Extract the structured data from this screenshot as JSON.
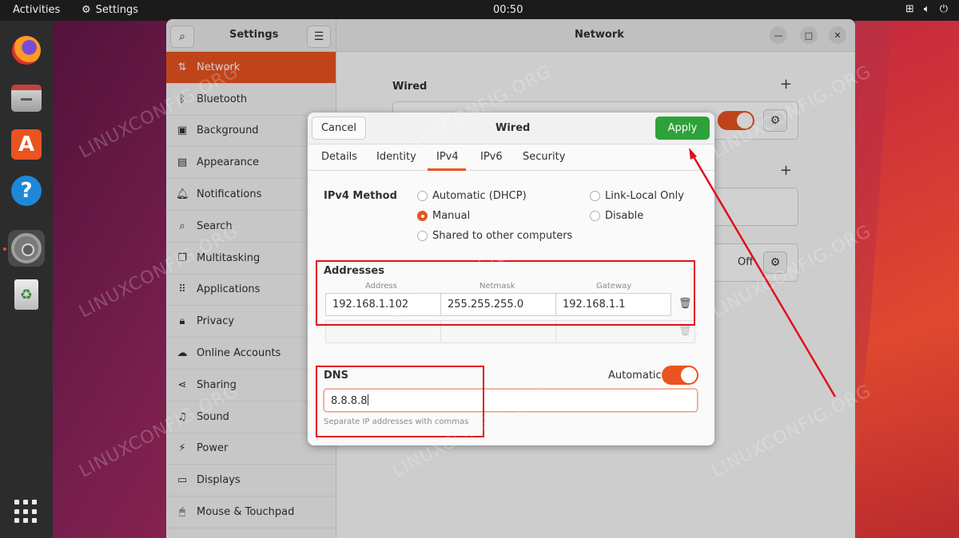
{
  "topbar": {
    "activities": "Activities",
    "app_name": "Settings",
    "clock": "00:50"
  },
  "settings": {
    "sidebar_title": "Settings",
    "main_title": "Network",
    "sidebar_items": [
      {
        "label": "Network",
        "icon": "network-icon"
      },
      {
        "label": "Bluetooth",
        "icon": "bluetooth-icon"
      },
      {
        "label": "Background",
        "icon": "background-icon"
      },
      {
        "label": "Appearance",
        "icon": "appearance-icon"
      },
      {
        "label": "Notifications",
        "icon": "bell-icon"
      },
      {
        "label": "Search",
        "icon": "search-icon"
      },
      {
        "label": "Multitasking",
        "icon": "multitasking-icon"
      },
      {
        "label": "Applications",
        "icon": "apps-grid-icon"
      },
      {
        "label": "Privacy",
        "icon": "lock-icon"
      },
      {
        "label": "Online Accounts",
        "icon": "cloud-icon"
      },
      {
        "label": "Sharing",
        "icon": "share-icon"
      },
      {
        "label": "Sound",
        "icon": "music-note-icon"
      },
      {
        "label": "Power",
        "icon": "power-icon"
      },
      {
        "label": "Displays",
        "icon": "display-icon"
      },
      {
        "label": "Mouse & Touchpad",
        "icon": "mouse-icon"
      }
    ],
    "wired_section": "Wired",
    "vpn_toggle_text": "Off"
  },
  "dialog": {
    "title": "Wired",
    "cancel": "Cancel",
    "apply": "Apply",
    "tabs": [
      "Details",
      "Identity",
      "IPv4",
      "IPv6",
      "Security"
    ],
    "active_tab": "IPv4",
    "ipv4_method_label": "IPv4 Method",
    "methods": {
      "automatic_dhcp": "Automatic (DHCP)",
      "manual": "Manual",
      "shared": "Shared to other computers",
      "link_local": "Link-Local Only",
      "disable": "Disable"
    },
    "selected_method": "Manual",
    "addresses_label": "Addresses",
    "columns": {
      "address": "Address",
      "netmask": "Netmask",
      "gateway": "Gateway"
    },
    "address_rows": [
      {
        "address": "192.168.1.102",
        "netmask": "255.255.255.0",
        "gateway": "192.168.1.1"
      },
      {
        "address": "",
        "netmask": "",
        "gateway": ""
      }
    ],
    "dns_label": "DNS",
    "dns_automatic_label": "Automatic",
    "dns_automatic_on": true,
    "dns_value": "8.8.8.8",
    "dns_hint": "Separate IP addresses with commas"
  },
  "watermark": "LINUXCONFIG.ORG",
  "colors": {
    "accent": "#e95420",
    "apply_green": "#2ea23a",
    "annotation_red": "#e0101a"
  }
}
